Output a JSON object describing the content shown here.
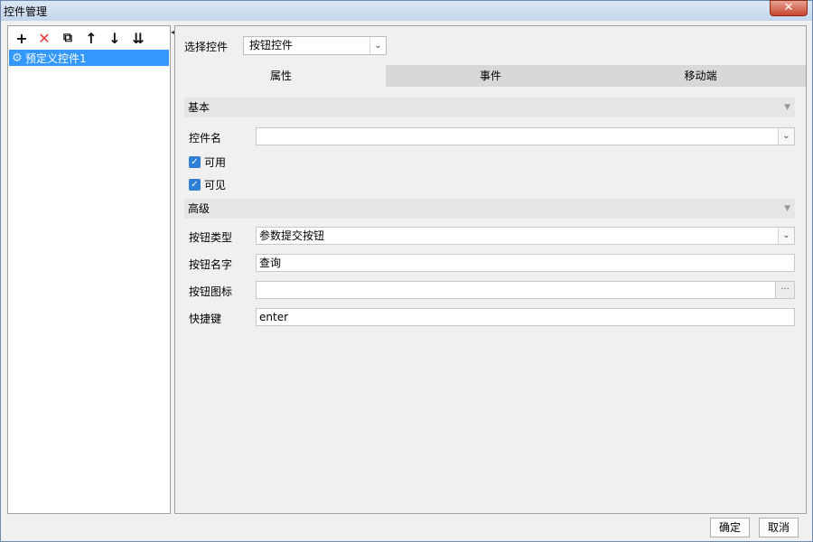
{
  "window": {
    "title": "控件管理",
    "close_glyph": "✕"
  },
  "toolbar": {
    "add": "+",
    "delete": "✕",
    "copy": "⧉",
    "up": "↑",
    "down": "↓",
    "sort": "⇊"
  },
  "tree": {
    "item_label": "预定义控件1",
    "item_icon": "⚙"
  },
  "collapse_glyph": "◂",
  "select": {
    "label": "选择控件",
    "value": "按钮控件",
    "arrow": "⌄"
  },
  "tabs": [
    {
      "label": "属性",
      "active": true
    },
    {
      "label": "事件",
      "active": false
    },
    {
      "label": "移动端",
      "active": false
    }
  ],
  "basic": {
    "title": "基本",
    "chevron": "▼",
    "name_label": "控件名",
    "name_value": "",
    "enabled_label": "可用",
    "visible_label": "可见",
    "check_glyph": "✓"
  },
  "advanced": {
    "title": "高级",
    "chevron": "▼",
    "type_label": "按钮类型",
    "type_value": "参数提交按钮",
    "btnname_label": "按钮名字",
    "btnname_value": "查询",
    "icon_label": "按钮图标",
    "icon_value": "",
    "icon_dots": "···",
    "hotkey_label": "快捷键",
    "hotkey_value": "enter"
  },
  "footer": {
    "ok_label": "确定",
    "cancel_label": "取消"
  }
}
